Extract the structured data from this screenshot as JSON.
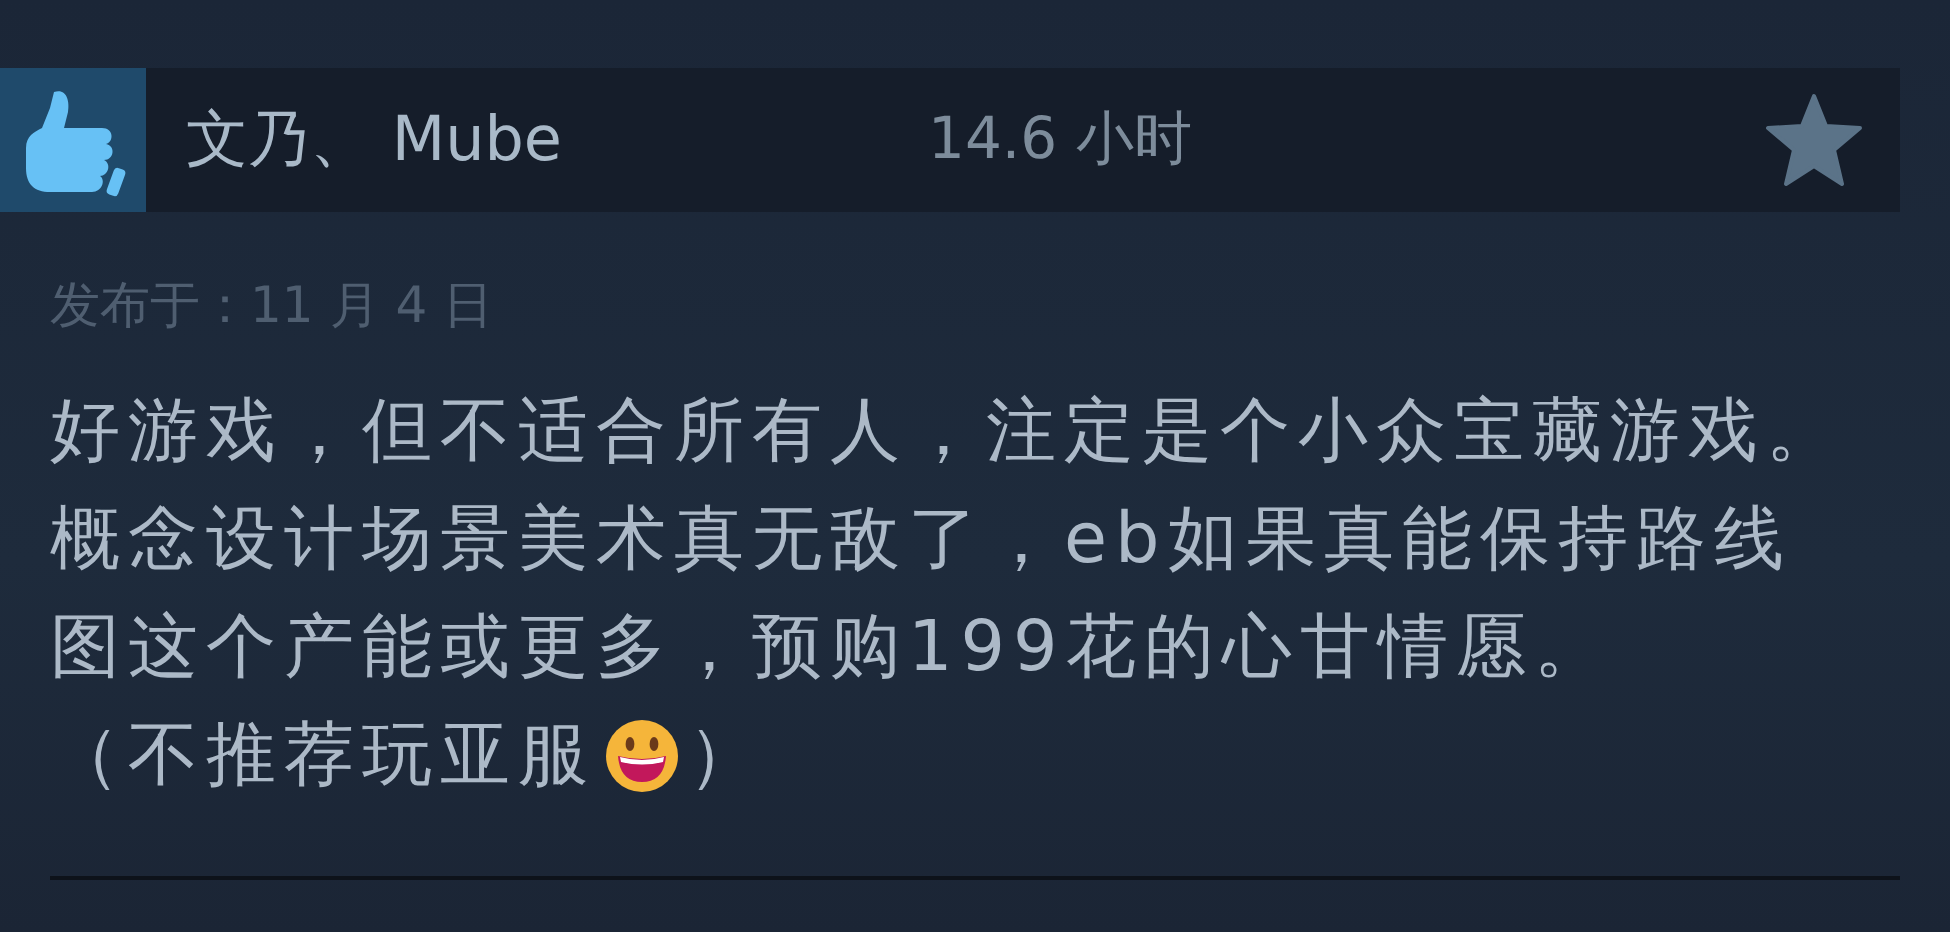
{
  "review": {
    "recommended": true,
    "author": "文乃、 Mube",
    "hours": "14.6 小时",
    "posted": "发布于：11 月 4 日",
    "paragraphs": [
      "好游戏，但不适合所有人，注定是个小众宝藏游戏。概念设计场景美术真无敌了，eb如果真能保持路线图这个产能或更多，预购199花的心甘情愿。"
    ],
    "aside": {
      "before": "（不推荐玩亚服",
      "after": "）"
    }
  }
}
